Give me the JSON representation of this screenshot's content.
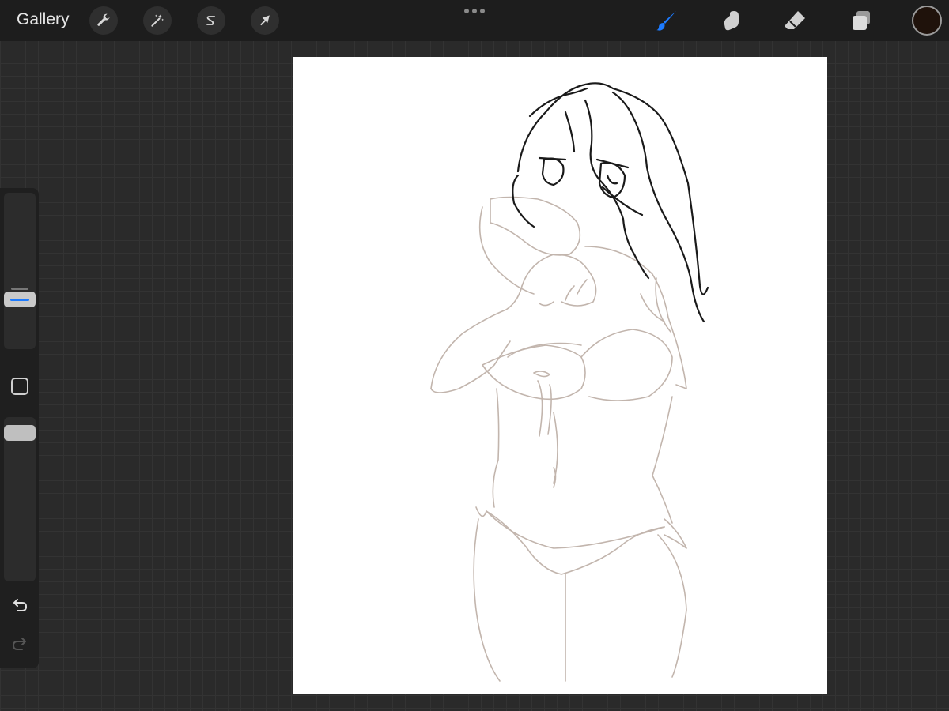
{
  "toolbar": {
    "gallery_label": "Gallery",
    "actions": [
      {
        "name": "actions",
        "icon": "wrench-icon"
      },
      {
        "name": "adjustments",
        "icon": "magic-wand-icon"
      },
      {
        "name": "selection",
        "icon": "selection-s-icon"
      },
      {
        "name": "transform",
        "icon": "arrow-cursor-icon"
      }
    ],
    "more_icon": "ellipsis-icon",
    "right_tools": [
      {
        "name": "brush",
        "icon": "brush-icon",
        "active": true
      },
      {
        "name": "smudge",
        "icon": "smudge-finger-icon",
        "active": false
      },
      {
        "name": "eraser",
        "icon": "eraser-icon",
        "active": false
      },
      {
        "name": "layers",
        "icon": "layers-icon",
        "active": false
      }
    ],
    "current_color": "#1f120b",
    "accent_color": "#1d7bff"
  },
  "sidebar": {
    "brush_size_level": 0.35,
    "opacity_level": 0.08,
    "modifier_icon": "square-modifier-icon",
    "undo_icon": "undo-icon",
    "redo_icon": "redo-icon"
  },
  "canvas": {
    "background": "#ffffff",
    "sketch_color": "#c2b5ad",
    "ink_color": "#1a1a1a"
  }
}
